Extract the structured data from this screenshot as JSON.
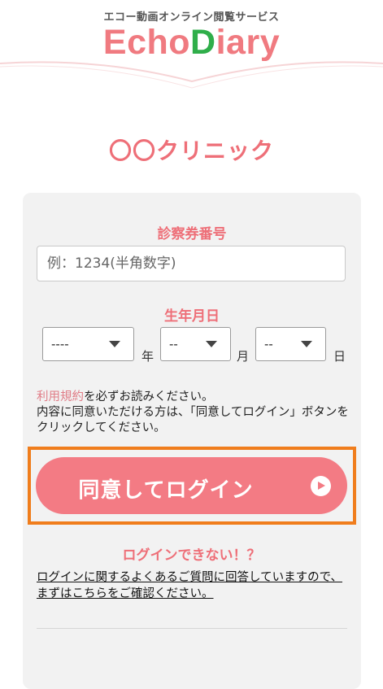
{
  "header": {
    "tagline": "エコー動画オンライン閲覧サービス",
    "logo": {
      "part1": "Echo",
      "part2": "D",
      "part3": "iary"
    }
  },
  "clinic_name": "〇〇クリニック",
  "form": {
    "card_number_label": "診察券番号",
    "card_number_placeholder": "例：1234(半角数字)",
    "card_number_value": "",
    "birthdate_label": "生年月日",
    "year_value": "----",
    "year_unit": "年",
    "month_value": "--",
    "month_unit": "月",
    "day_value": "--",
    "day_unit": "日"
  },
  "notice": {
    "terms_link": "利用規約",
    "line1_rest": "を必ずお読みください。",
    "line2": "内容に同意いただける方は、「同意してログイン」ボタンをクリックしてください。"
  },
  "login_button": {
    "label": "同意してログイン",
    "icon": "play-circle-icon"
  },
  "help": {
    "cant_login": "ログインできない！？",
    "faq_text": "ログインに関するよくあるご質問に回答していますので、まずはこちらをご確認ください。"
  },
  "colors": {
    "accent": "#ee6f78",
    "button": "#f37b84",
    "highlight_frame": "#f07d1c",
    "logo_green": "#2fae4a",
    "card_bg": "#f2f2f2"
  }
}
